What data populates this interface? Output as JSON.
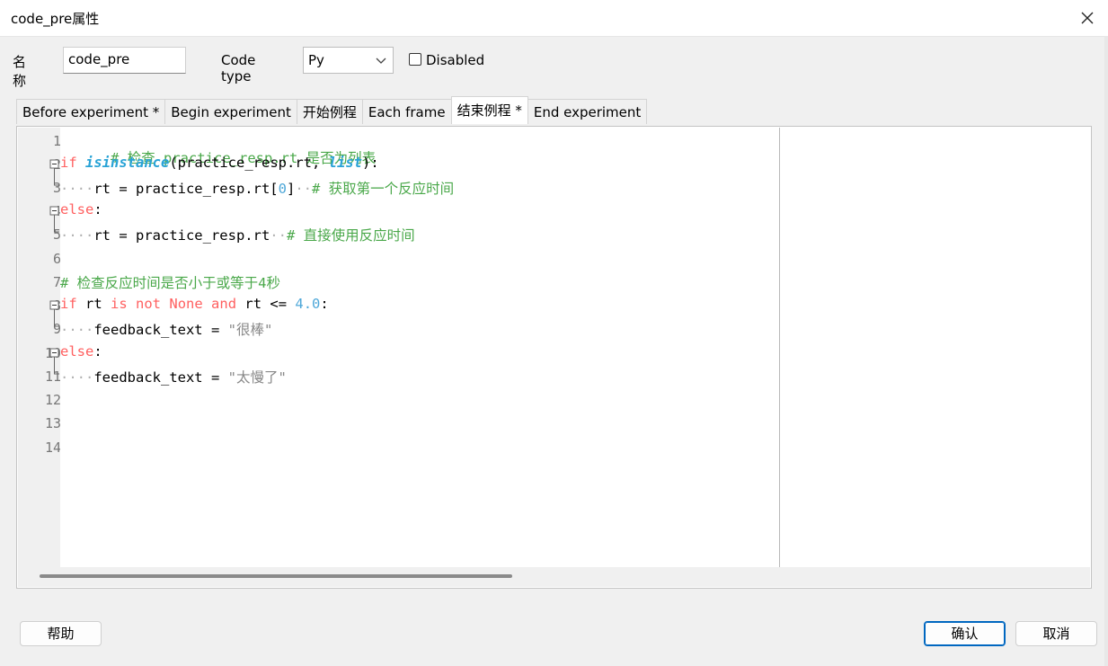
{
  "window": {
    "title": "code_pre属性"
  },
  "form": {
    "name_label": "名称",
    "name_value": "code_pre",
    "code_type_label": "Code type",
    "code_type_value": "Py",
    "disabled_label": "Disabled"
  },
  "tabs": [
    {
      "label": "Before experiment *"
    },
    {
      "label": "Begin experiment"
    },
    {
      "label": "开始例程"
    },
    {
      "label": "Each frame"
    },
    {
      "label": "结束例程 *"
    },
    {
      "label": "End experiment"
    }
  ],
  "editor": {
    "line_numbers": [
      "1",
      "2",
      "3",
      "4",
      "5",
      "6",
      "7",
      "8",
      "9",
      "10",
      "11",
      "12",
      "13",
      "14"
    ],
    "tokens": {
      "l1": "# 检查 practice_resp.rt 是否为列表",
      "l2_if": "if",
      "l2_fn": "isinstance",
      "l2_mid": "(practice_resp.rt, ",
      "l2_list": "list",
      "l2_end": "):",
      "l3_code": "rt = practice_resp.rt[",
      "l3_num": "0",
      "l3_close": "]",
      "l3_cm": "# 获取第一个反应时间",
      "l4_else": "else",
      "l4_colon": ":",
      "l5_code": "rt = practice_resp.rt",
      "l5_cm": "# 直接使用反应时间",
      "l7_cm": "# 检查反应时间是否小于或等于4秒",
      "l8_if": "if",
      "l8_rt": " rt ",
      "l8_is": "is",
      "l8_not": "not",
      "l8_none": "None",
      "l8_and": "and",
      "l8_cmp": " rt <= ",
      "l8_num": "4.0",
      "l8_colon": ":",
      "l9_code": "feedback_text = ",
      "l9_str": "\"很棒\"",
      "l10_else": "else",
      "l10_colon": ":",
      "l11_code": "feedback_text = ",
      "l11_str": "\"太慢了\""
    }
  },
  "buttons": {
    "help": "帮助",
    "ok": "确认",
    "cancel": "取消"
  }
}
